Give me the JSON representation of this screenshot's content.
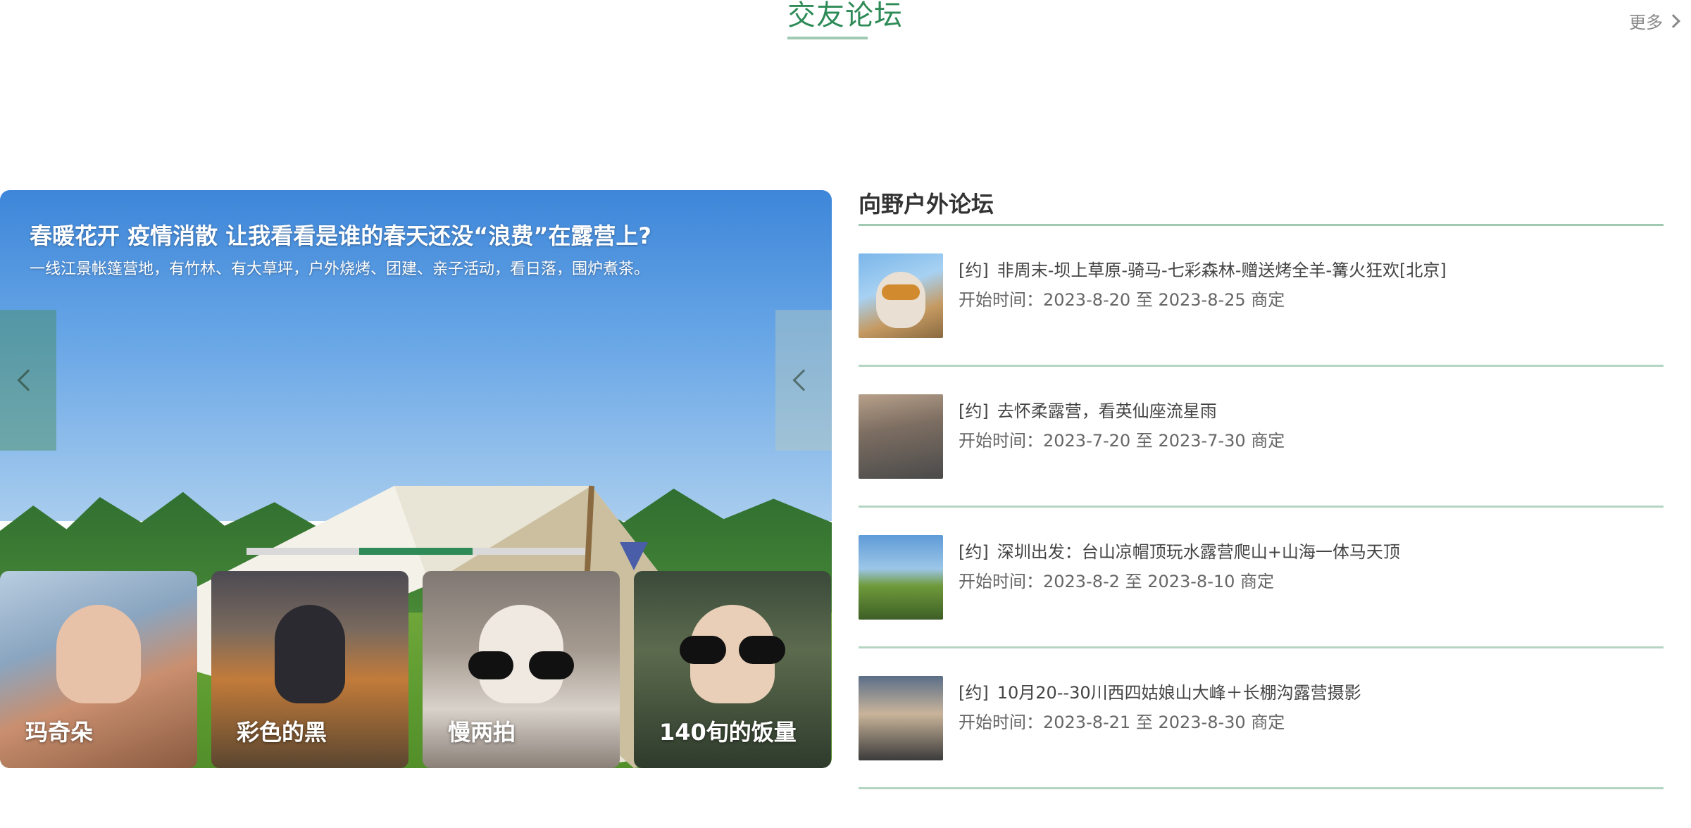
{
  "section": {
    "title": "交友论坛",
    "more_label": "更多",
    "accent_color": "#2e8b57"
  },
  "carousel": {
    "slide_title": "春暖花开 疫情消散 让我看看是谁的春天还没“浪费”在露营上?",
    "slide_desc": "一线江景帐篷营地，有竹林、有大草坪，户外烧烤、团建、亲子活动，看日落，围炉煮茶。",
    "progress": {
      "segments": 3,
      "active_index": 1
    },
    "thumbnails": [
      {
        "name": "玛奇朵"
      },
      {
        "name": "彩色的黑"
      },
      {
        "name": "慢两拍"
      },
      {
        "name": "140旬的饭量"
      }
    ]
  },
  "forum": {
    "header": "向野户外论坛",
    "posts": [
      {
        "tag": "[约]",
        "title": "非周末-坝上草原-骑马-七彩森林-赠送烤全羊-篝火狂欢[北京]",
        "time": "开始时间：2023-8-20  至 2023-8-25  商定"
      },
      {
        "tag": "[约]",
        "title": "去怀柔露营，看英仙座流星雨",
        "time": "开始时间：2023-7-20  至 2023-7-30  商定"
      },
      {
        "tag": "[约]",
        "title": "深圳出发：台山凉帽顶玩水露营爬山+山海一体马天顶",
        "time": "开始时间：2023-8-2  至 2023-8-10  商定"
      },
      {
        "tag": "[约]",
        "title": "10月20--30川西四姑娘山大峰＋长棚沟露营摄影",
        "time": "开始时间：2023-8-21  至 2023-8-30  商定"
      }
    ]
  }
}
